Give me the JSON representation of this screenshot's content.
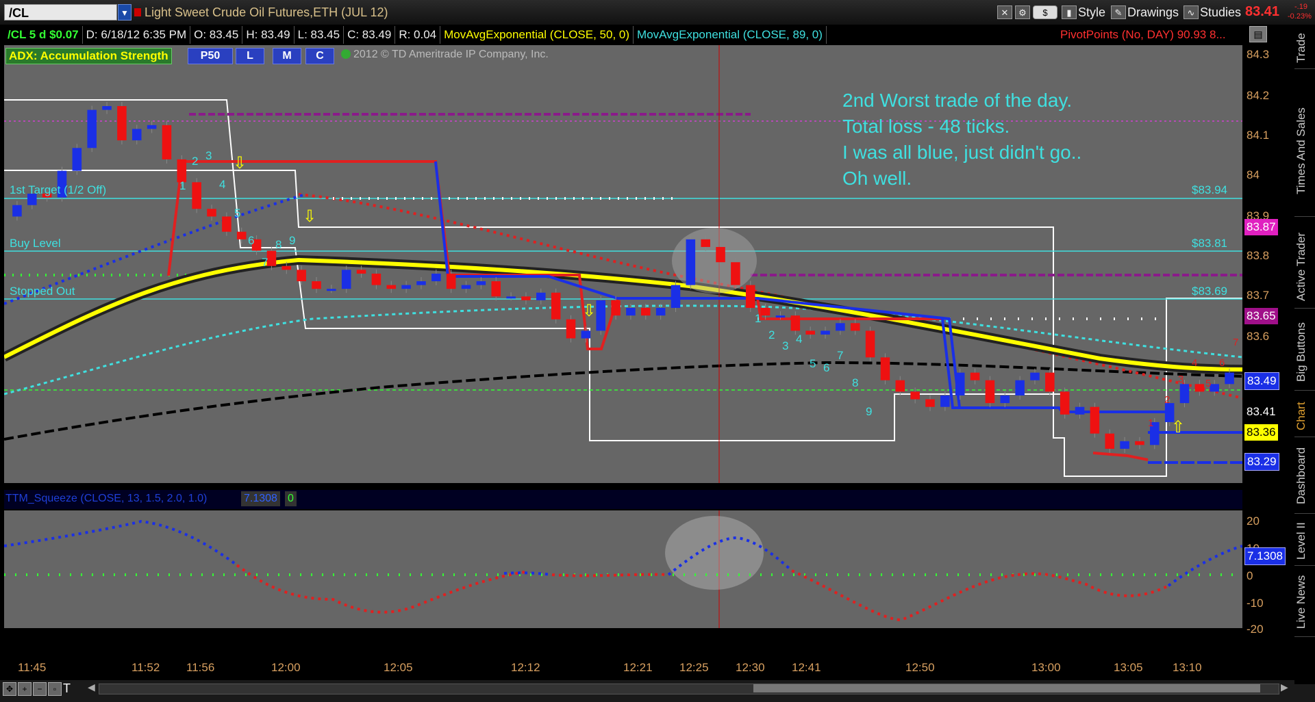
{
  "toolbar": {
    "symbol": "/CL",
    "instrument_title": "Light Sweet Crude Oil Futures,ETH (JUL 12)",
    "style_label": "Style",
    "drawings_label": "Drawings",
    "studies_label": "Studies",
    "last_price": "83.41",
    "change_1": "-.19",
    "change_2": "-0.23%",
    "dollar_label": "$"
  },
  "info": {
    "tick": "/CL 5 d $0.07",
    "date": "D: 6/18/12 6:35 PM",
    "open": "O: 83.45",
    "high": "H: 83.49",
    "low": "L: 83.45",
    "close": "C: 83.49",
    "range": "R: 0.04",
    "ema50": "MovAvgExponential (CLOSE, 50, 0)",
    "ema89": "MovAvgExponential (CLOSE, 89, 0)",
    "pivot": "PivotPoints (No, DAY)",
    "pivot_val": "90.93",
    "pivot_more": "8..."
  },
  "indicator_bar": {
    "adx": "ADX:  Accumulation Strength",
    "p50": "P50",
    "l": "L",
    "m": "M",
    "c": "C",
    "copyright": "2012 © TD Ameritrade IP Company, Inc."
  },
  "annotation": {
    "line1": "2nd Worst trade of the day.",
    "line2": "Total loss - 48 ticks.",
    "line3": "I was all blue, just didn't go..",
    "line4": "Oh well."
  },
  "levels": {
    "target_label": "1st Target (1/2 Off)",
    "target_price": "$83.94",
    "buy_label": "Buy Level",
    "buy_price": "$83.81",
    "stop_label": "Stopped Out",
    "stop_price": "$83.69"
  },
  "price_axis": {
    "ticks": [
      "84.3",
      "84.2",
      "84.1",
      "84",
      "83.9",
      "83.8",
      "83.7",
      "83.6"
    ],
    "box_87": "83.87",
    "box_65": "83.65",
    "box_49": "83.49",
    "box_41": "83.41",
    "box_36": "83.36",
    "box_29": "83.29"
  },
  "squeeze": {
    "label": "TTM_Squeeze (CLOSE, 13, 1.5, 2.0, 1.0)",
    "value": "7.1308",
    "zero": "0",
    "ticks": [
      "20",
      "10",
      "0",
      "-10",
      "-20"
    ],
    "current": "7.1308"
  },
  "time_axis": [
    "11:45",
    "11:52",
    "11:56",
    "12:00",
    "12:05",
    "12:12",
    "12:21",
    "12:25",
    "12:30",
    "12:41",
    "12:50",
    "13:00",
    "13:05",
    "13:10"
  ],
  "side_tabs": [
    "Trade",
    "Times And Sales",
    "Active Trader",
    "Big Buttons",
    "Chart",
    "Dashboard",
    "Level II",
    "Live News"
  ],
  "bar_counts_left": [
    "1",
    "2",
    "3",
    "4",
    "5",
    "6",
    "7",
    "8",
    "9"
  ],
  "bar_counts_mid": [
    "1",
    "2",
    "3",
    "4",
    "5",
    "6",
    "7",
    "8",
    "9"
  ],
  "bar_counts_right": [
    "1",
    "2",
    "3",
    "4",
    "5",
    "6",
    "7"
  ],
  "colors": {
    "up": "#1a2fe6",
    "down": "#ee1111",
    "cyan": "#3fe0e0",
    "yellow": "#ffff00",
    "purple": "#8a1a8a"
  },
  "chart_data": {
    "type": "candlestick",
    "title": "/CL 5 d $0.07",
    "ylim": [
      83.2,
      84.35
    ],
    "x_ticks": [
      "11:45",
      "11:52",
      "11:56",
      "12:00",
      "12:05",
      "12:12",
      "12:21",
      "12:25",
      "12:30",
      "12:41",
      "12:50",
      "13:00",
      "13:05",
      "13:10"
    ],
    "close_approx": [
      83.93,
      83.96,
      83.95,
      84.02,
      84.08,
      84.18,
      84.19,
      84.1,
      84.13,
      84.14,
      84.05,
      83.99,
      83.92,
      83.9,
      83.86,
      83.84,
      83.81,
      83.77,
      83.76,
      83.73,
      83.71,
      83.71,
      83.76,
      83.75,
      83.72,
      83.71,
      83.72,
      83.73,
      83.75,
      83.71,
      83.72,
      83.73,
      83.69,
      83.69,
      83.68,
      83.7,
      83.63,
      83.58,
      83.6,
      83.68,
      83.64,
      83.66,
      83.64,
      83.66,
      83.72,
      83.84,
      83.82,
      83.78,
      83.72,
      83.66,
      83.64,
      83.64,
      83.6,
      83.59,
      83.6,
      83.62,
      83.6,
      83.53,
      83.47,
      83.44,
      83.42,
      83.4,
      83.43,
      83.49,
      83.47,
      83.41,
      83.43,
      83.47,
      83.49,
      83.44,
      83.38,
      83.4,
      83.33,
      83.29,
      83.31,
      83.3,
      83.36,
      83.41,
      83.46,
      83.44,
      83.46,
      83.49
    ]
  }
}
